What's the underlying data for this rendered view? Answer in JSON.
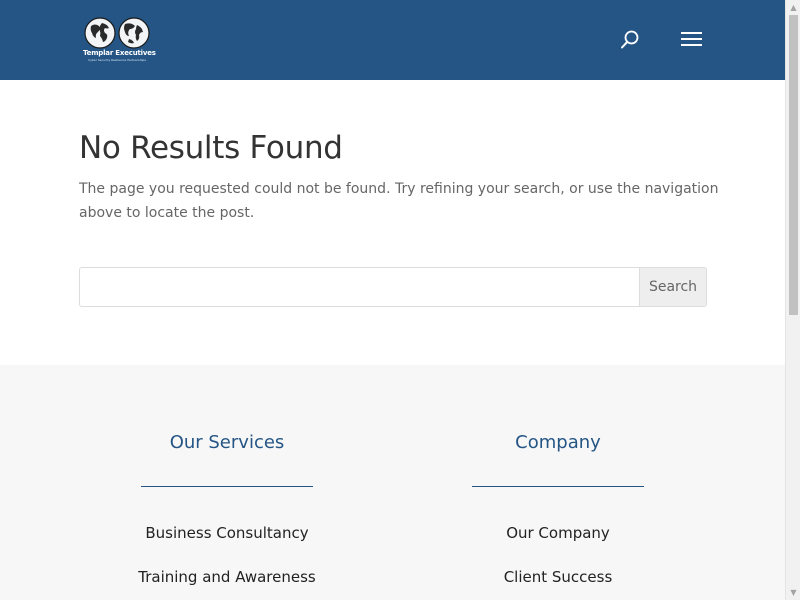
{
  "header": {
    "logo": {
      "title": "Templar Executives",
      "tagline": "Cyber Security Resilience Partnerships"
    },
    "search_icon": "search-icon",
    "menu_icon": "hamburger-menu-icon",
    "background": "#245585"
  },
  "main": {
    "title": "No Results Found",
    "message": "The page you requested could not be found. Try refining your search, or use the navigation above to locate the post.",
    "search": {
      "value": "",
      "placeholder": "",
      "button_label": "Search"
    }
  },
  "footer": {
    "columns": [
      {
        "heading": "Our Services",
        "links": [
          "Business Consultancy",
          "Training and Awareness"
        ]
      },
      {
        "heading": "Company",
        "links": [
          "Our Company",
          "Client Success"
        ]
      }
    ],
    "accent": "#245585",
    "background": "#f7f7f7"
  }
}
